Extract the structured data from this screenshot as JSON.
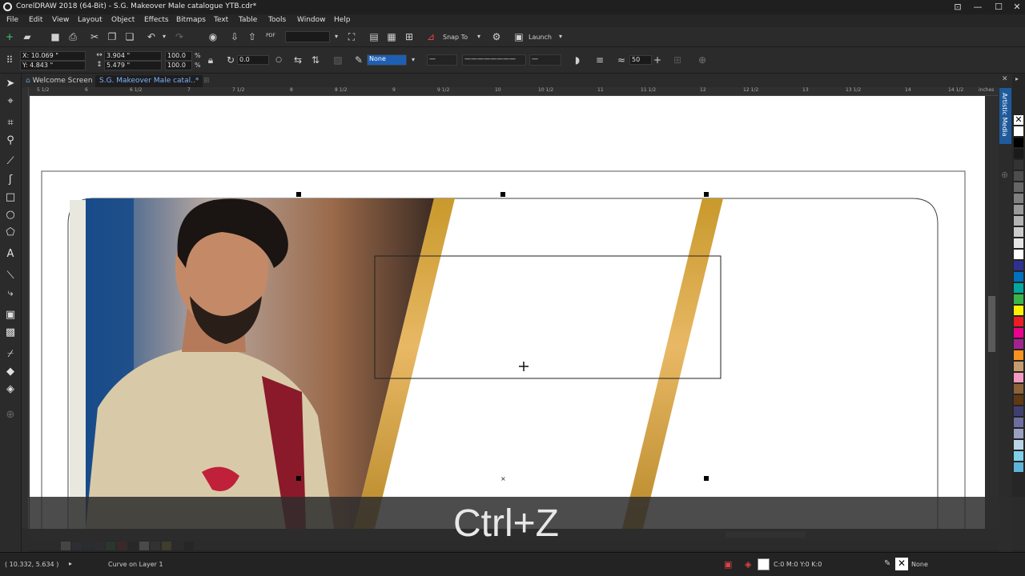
{
  "app": {
    "title": "CorelDRAW 2018 (64-Bit) - S.G. Makeover Male catalogue YTB.cdr*"
  },
  "window_controls": {
    "minimize": "—",
    "maximize": "☐",
    "close": "✕"
  },
  "menu": [
    "File",
    "Edit",
    "View",
    "Layout",
    "Object",
    "Effects",
    "Bitmaps",
    "Text",
    "Table",
    "Tools",
    "Window",
    "Help"
  ],
  "toolbar": {
    "snap_to": "Snap To",
    "launch": "Launch",
    "zoom_value": "",
    "pdf_label": "PDF"
  },
  "property_bar": {
    "x": "X: 10.069 \"",
    "y": "Y: 4.843 \"",
    "width": "3.904 \"",
    "height": "5.479 \"",
    "scale_x": "100.0",
    "scale_y": "100.0",
    "percent": "%",
    "rotation": "0.0",
    "outline_fill": "None",
    "outline_width": "50"
  },
  "tabs": [
    {
      "label": "Welcome Screen",
      "active": false
    },
    {
      "label": "S.G. Makeover Male catal..*",
      "active": true
    }
  ],
  "ruler": {
    "h_labels": [
      "5 1/2",
      "6",
      "6 1/2",
      "7",
      "7 1/2",
      "8",
      "8 1/2",
      "9",
      "9 1/2",
      "10",
      "10 1/2",
      "11",
      "11 1/2",
      "12",
      "12 1/2",
      "13",
      "13 1/2",
      "14",
      "14 1/2"
    ],
    "units": "inches"
  },
  "docker": {
    "label": "Artistic Media"
  },
  "overlay": {
    "shortcut": "Ctrl+Z"
  },
  "status": {
    "coords": "( 10.332, 5.634 )",
    "object_info": "Curve on Layer 1",
    "fill_info": "C:0 M:0 Y:0 K:0",
    "outline_info": "None"
  },
  "colors": {
    "gold": "#c9992c",
    "canvas_bg": "#ffffff",
    "ui_bg": "#2b2b2b",
    "accent": "#4a90e2"
  },
  "palette": [
    "#ffffff",
    "#000000",
    "#1a1a1a",
    "#333333",
    "#4d4d4d",
    "#666666",
    "#808080",
    "#999999",
    "#b3b3b3",
    "#cccccc",
    "#e6e6e6",
    "#ffffff",
    "#2e3192",
    "#0071bc",
    "#00a99d",
    "#39b54a",
    "#fff200",
    "#ed1c24",
    "#ec008c",
    "#a3238e",
    "#f7931e",
    "#c69c6d",
    "#f49ac1",
    "#8c6239",
    "#603813",
    "#3f3f6f",
    "#6d6d9f",
    "#9aa0c0",
    "#b8d4e6",
    "#7fcfe8",
    "#5eb4d6"
  ]
}
